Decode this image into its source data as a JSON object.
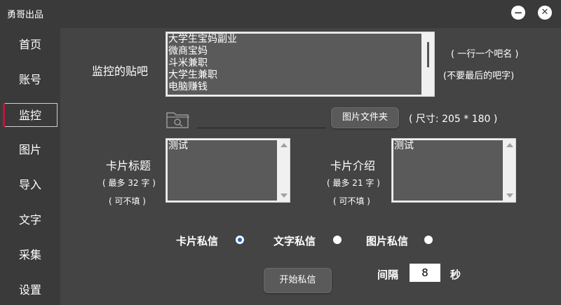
{
  "window": {
    "title": "勇哥出品",
    "minimize_label": "−",
    "close_label": "✕"
  },
  "sidebar": {
    "items": [
      {
        "label": "首页"
      },
      {
        "label": "账号"
      },
      {
        "label": "监控",
        "active": true
      },
      {
        "label": "图片"
      },
      {
        "label": "导入"
      },
      {
        "label": "文字"
      },
      {
        "label": "采集"
      },
      {
        "label": "设置"
      }
    ]
  },
  "monitor": {
    "label": "监控的贴吧",
    "bars": [
      "大学生宝妈副业",
      "微商宝妈",
      "斗米兼职",
      "大学生兼职",
      "电脑赚钱"
    ],
    "hint_one_per_line": "( 一行一个吧名 )",
    "hint_no_suffix": "(不要最后的吧字)"
  },
  "image_folder": {
    "folder_icon": "folder-search-icon",
    "path_value": "",
    "button_label": "图片文件夹",
    "size_hint": "( 尺寸: 205 * 180 )"
  },
  "card_title": {
    "label": "卡片标题",
    "limit": "( 最多 32 字 )",
    "optional": "( 可不填 )",
    "value": "测试"
  },
  "card_intro": {
    "label": "卡片介绍",
    "limit": "( 最多 21 字 )",
    "optional": "( 可不填 )",
    "value": "测试"
  },
  "message_type": {
    "options": [
      {
        "label": "卡片私信",
        "selected": true
      },
      {
        "label": "文字私信",
        "selected": false
      },
      {
        "label": "图片私信",
        "selected": false
      }
    ]
  },
  "actions": {
    "start_label": "开始私信"
  },
  "interval": {
    "label": "间隔",
    "value": "8",
    "unit": "秒"
  },
  "colors": {
    "background": "#3a3a3a",
    "panel": "#444444",
    "field": "#5a5a5a",
    "accent": "#c0143c",
    "radio_selected": "#1e62d0"
  }
}
